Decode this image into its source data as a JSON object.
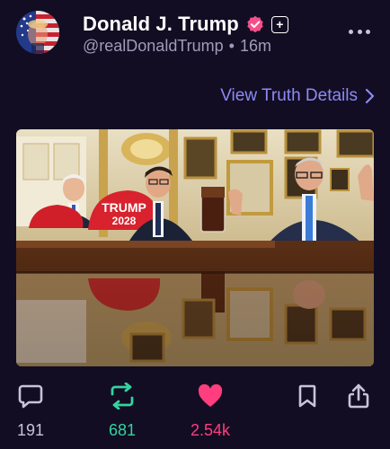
{
  "post": {
    "author": {
      "display_name": "Donald J. Trump",
      "handle": "@realDonaldTrump",
      "separator": "•",
      "time_ago": "16m",
      "verified_icon": "verified-badge-icon",
      "plus_icon": "plus-badge-icon"
    },
    "details_link": {
      "label": "View Truth Details",
      "icon": "chevron-right-icon"
    },
    "image": {
      "hat_text_line1": "TRUMP",
      "hat_text_line2": "2028"
    },
    "actions": {
      "replies": {
        "icon": "reply-bubble-icon",
        "count": "191"
      },
      "retruths": {
        "icon": "retruth-icon",
        "count": "681"
      },
      "likes": {
        "icon": "heart-icon",
        "count": "2.54k"
      },
      "bookmark": {
        "icon": "bookmark-icon"
      },
      "share": {
        "icon": "share-icon"
      }
    }
  },
  "colors": {
    "background": "#120d22",
    "accent_link": "#8d8af5",
    "retruth_green": "#34d3a0",
    "like_pink": "#ff3d7f",
    "verified_pink": "#f54f8a",
    "muted_text": "#a09cb8"
  }
}
